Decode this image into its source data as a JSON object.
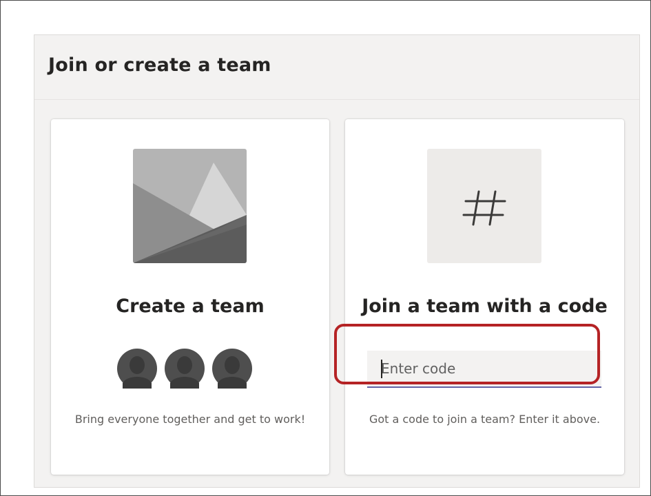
{
  "dialog": {
    "title": "Join or create a team"
  },
  "create_card": {
    "title": "Create a team",
    "description": "Bring everyone together and get to work!",
    "image_icon": "mountain-image-icon",
    "avatar_icon": "person-avatar-icon"
  },
  "join_card": {
    "title": "Join a team with a code",
    "input_placeholder": "Enter code",
    "input_value": "",
    "description": "Got a code to join a team? Enter it above.",
    "tile_icon": "hash-icon"
  },
  "colors": {
    "accent": "#6264a7",
    "highlight": "#b52325",
    "panel_bg": "#f3f2f1"
  }
}
